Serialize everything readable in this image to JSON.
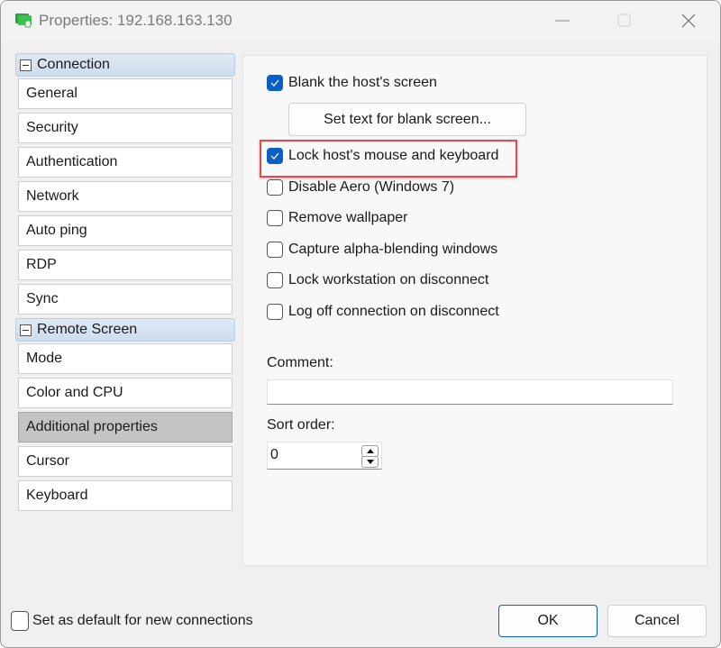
{
  "window": {
    "title": "Properties: 192.168.163.130",
    "icon": "monitor-lock-icon",
    "controls": [
      "minimize",
      "maximize",
      "close"
    ]
  },
  "sidebar": {
    "groups": [
      {
        "label": "Connection",
        "items": [
          {
            "label": "General"
          },
          {
            "label": "Security"
          },
          {
            "label": "Authentication"
          },
          {
            "label": "Network"
          },
          {
            "label": "Auto ping"
          },
          {
            "label": "RDP"
          },
          {
            "label": "Sync"
          }
        ]
      },
      {
        "label": "Remote Screen",
        "items": [
          {
            "label": "Mode"
          },
          {
            "label": "Color and CPU"
          },
          {
            "label": "Additional properties",
            "selected": true
          },
          {
            "label": "Cursor"
          },
          {
            "label": "Keyboard"
          }
        ]
      }
    ]
  },
  "panel": {
    "blank_screen": {
      "label": "Blank the host's screen",
      "checked": true
    },
    "set_text_button": "Set text for blank screen...",
    "options": [
      {
        "label": "Lock host's mouse and keyboard",
        "checked": true,
        "highlighted": true
      },
      {
        "label": "Disable Aero (Windows 7)",
        "checked": false
      },
      {
        "label": "Remove wallpaper",
        "checked": false
      },
      {
        "label": "Capture alpha-blending windows",
        "checked": false
      },
      {
        "label": "Lock workstation on disconnect",
        "checked": false
      },
      {
        "label": "Log off connection on disconnect",
        "checked": false
      }
    ],
    "comment": {
      "label": "Comment:",
      "value": ""
    },
    "sort_order": {
      "label": "Sort order:",
      "value": "0"
    }
  },
  "footer": {
    "default_checkbox": {
      "label": "Set as default for new connections",
      "checked": false
    },
    "ok": "OK",
    "cancel": "Cancel"
  },
  "colors": {
    "accent": "#0a5fc4",
    "highlight": "#e5484d",
    "selected_item": "#c4c4c4"
  }
}
